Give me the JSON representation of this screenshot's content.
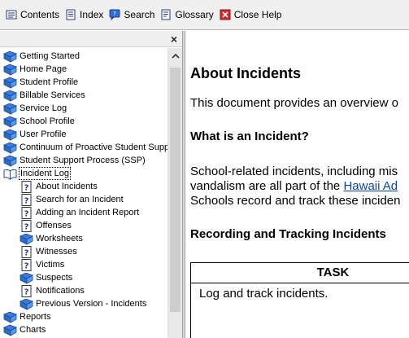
{
  "toolbar": {
    "contents": "Contents",
    "index": "Index",
    "search": "Search",
    "glossary": "Glossary",
    "close_help": "Close Help"
  },
  "left_pane": {
    "close": "×",
    "tree": [
      {
        "label": "Getting Started",
        "icon": "book-icon"
      },
      {
        "label": "Home Page",
        "icon": "book-icon"
      },
      {
        "label": "Student Profile",
        "icon": "book-icon"
      },
      {
        "label": "Billable Services",
        "icon": "book-icon"
      },
      {
        "label": "Service Log",
        "icon": "book-icon"
      },
      {
        "label": "School Profile",
        "icon": "book-icon"
      },
      {
        "label": "User Profile",
        "icon": "book-icon"
      },
      {
        "label": "Continuum of Proactive Student Suppo",
        "icon": "book-icon"
      },
      {
        "label": "Student Support Process (SSP)",
        "icon": "book-icon"
      },
      {
        "label": "Incident Log",
        "icon": "open-book-icon"
      },
      {
        "label": "About Incidents",
        "icon": "help-page-icon"
      },
      {
        "label": "Search for an Incident",
        "icon": "help-page-icon"
      },
      {
        "label": "Adding an Incident Report",
        "icon": "help-page-icon"
      },
      {
        "label": "Offenses",
        "icon": "help-page-icon"
      },
      {
        "label": "Worksheets",
        "icon": "book-icon"
      },
      {
        "label": "Witnesses",
        "icon": "help-page-icon"
      },
      {
        "label": "Victims",
        "icon": "help-page-icon"
      },
      {
        "label": "Suspects",
        "icon": "book-icon"
      },
      {
        "label": "Notifications",
        "icon": "help-page-icon"
      },
      {
        "label": "Previous Version - Incidents",
        "icon": "book-icon"
      },
      {
        "label": "Reports",
        "icon": "book-icon"
      },
      {
        "label": "Charts",
        "icon": "book-icon"
      }
    ]
  },
  "content": {
    "title": "About Incidents",
    "intro": "This document provides an overview o",
    "h_what": "What is an Incident?",
    "p1_line1": "School-related incidents, including mis",
    "p1_line2_pre": "vandalism are all part of the ",
    "p1_link": "Hawaii Ad",
    "p1_line3": "Schools record and track these inciden",
    "h_record": "Recording and Tracking Incidents",
    "table_header": "TASK",
    "table_cell": "Log and track incidents."
  },
  "colors": {
    "link": "#0645ad",
    "book": "#2b6fc4",
    "close_red": "#d22a2a"
  }
}
